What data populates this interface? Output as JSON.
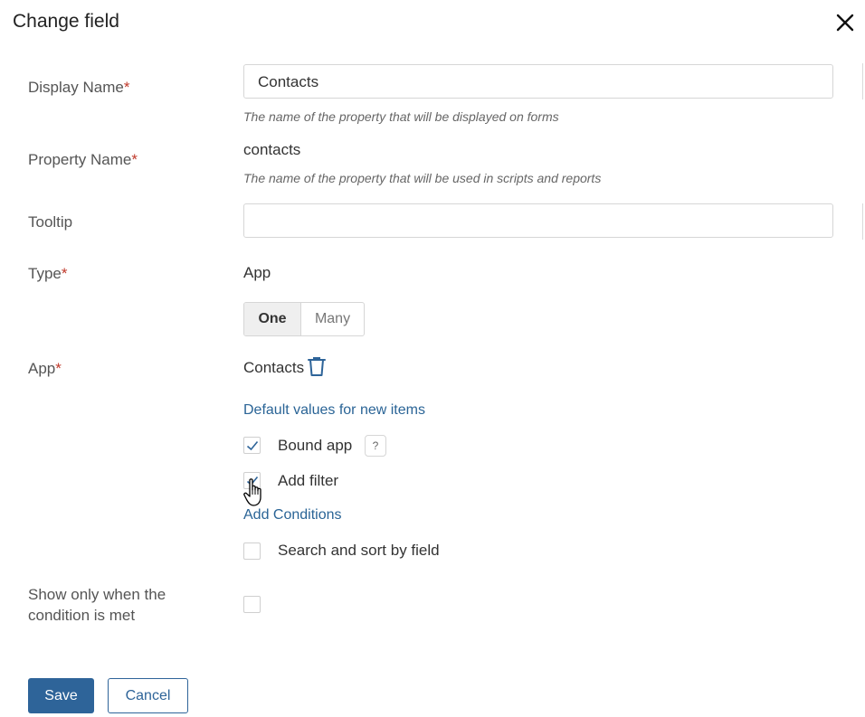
{
  "dialog": {
    "title": "Change field"
  },
  "fields": {
    "display_name": {
      "label": "Display Name",
      "required": "*",
      "value": "Contacts",
      "hint": "The name of the property that will be displayed on forms"
    },
    "property_name": {
      "label": "Property Name",
      "required": "*",
      "value": "contacts",
      "hint": "The name of the property that will be used in scripts and reports"
    },
    "tooltip": {
      "label": "Tooltip",
      "value": ""
    },
    "type": {
      "label": "Type",
      "required": "*",
      "value": "App",
      "options": [
        "One",
        "Many"
      ],
      "selected": "One"
    },
    "app": {
      "label": "App",
      "required": "*",
      "value": "Contacts",
      "default_values_link": "Default values for new items",
      "bound_app": {
        "label": "Bound app",
        "checked": true,
        "help": "?"
      },
      "add_filter": {
        "label": "Add filter",
        "checked": true
      },
      "add_conditions_link": "Add Conditions",
      "search_sort": {
        "label": "Search and sort by field",
        "checked": false
      }
    },
    "show_condition": {
      "label_line1": "Show only when the",
      "label_line2": "condition is met",
      "checked": false
    }
  },
  "buttons": {
    "save": "Save",
    "cancel": "Cancel"
  },
  "colors": {
    "accent": "#2e6499",
    "link": "#2a6496",
    "required": "#c0392b"
  }
}
